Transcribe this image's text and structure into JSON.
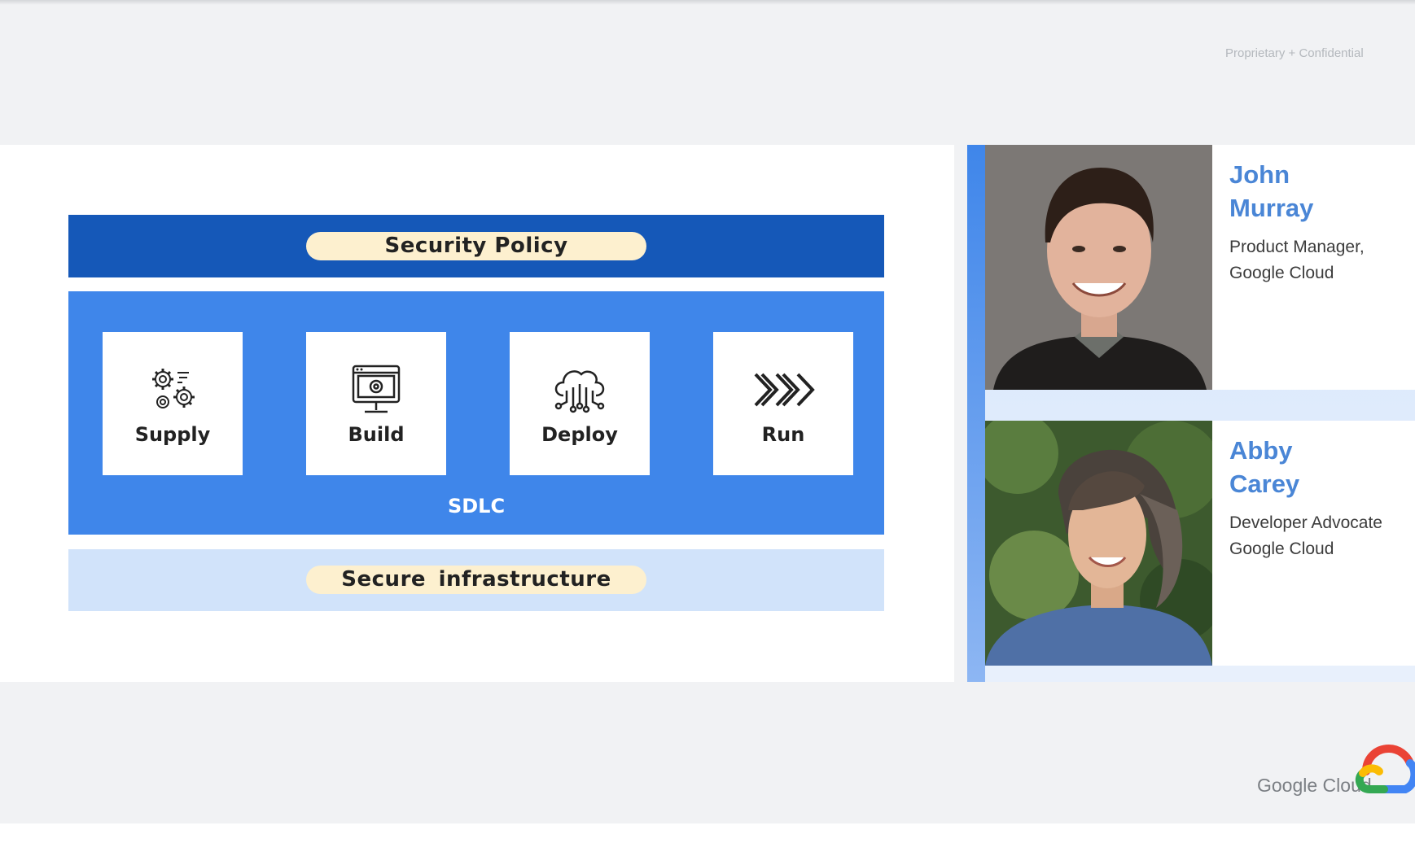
{
  "header": {
    "confidential_label": "Proprietary + Confidential"
  },
  "diagram": {
    "policy_label": "Security Policy",
    "stages": [
      {
        "label": "Supply",
        "icon": "gears-icon"
      },
      {
        "label": "Build",
        "icon": "monitor-gear-icon"
      },
      {
        "label": "Deploy",
        "icon": "cloud-circuit-icon"
      },
      {
        "label": "Run",
        "icon": "chevrons-right-icon"
      }
    ],
    "sdlc_label": "SDLC",
    "infra_label": "Secure  infrastructure"
  },
  "speakers": [
    {
      "first": "John",
      "last": "Murray",
      "role_line1": "Product Manager,",
      "role_line2": "Google Cloud"
    },
    {
      "first": "Abby",
      "last": "Carey",
      "role_line1": "Developer Advocate",
      "role_line2": "Google Cloud"
    }
  ],
  "branding": {
    "logo_text": "Google Cloud"
  },
  "colors": {
    "policy_bar": "#1558b8",
    "sdlc_panel": "#3f86ea",
    "infra_bar": "#d1e3fa",
    "pill": "#fdf0cf",
    "speaker_name": "#4a86d6"
  }
}
